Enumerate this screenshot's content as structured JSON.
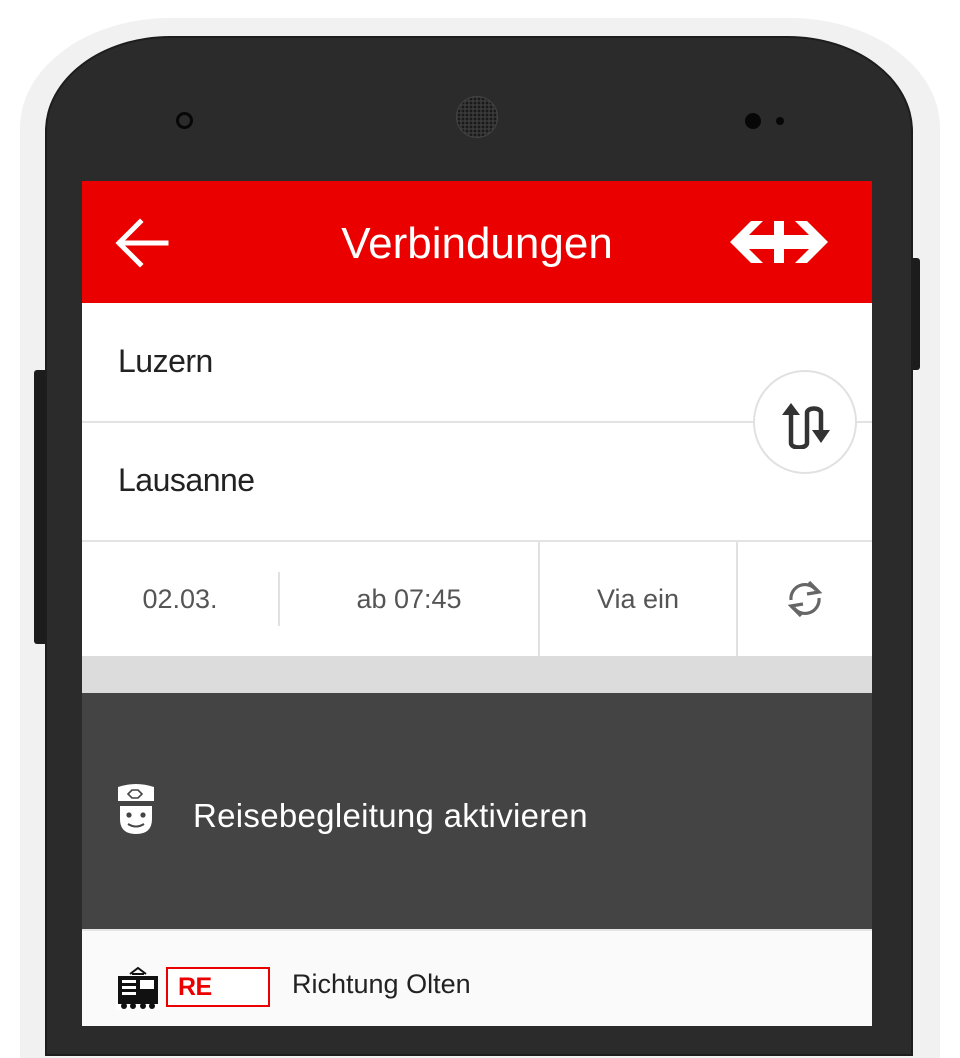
{
  "app": {
    "title": "Verbindungen",
    "accent_color": "#eb0000",
    "back_icon": "arrow-left-icon",
    "logo": "sbb-logo"
  },
  "search": {
    "from": "Luzern",
    "to": "Lausanne",
    "swap_icon": "swap-direction-icon"
  },
  "options": {
    "date": "02.03.",
    "time": "ab 07:45",
    "via": "Via ein",
    "refresh_icon": "refresh-icon"
  },
  "travel_companion": {
    "label": "Reisebegleitung aktivieren",
    "icon": "conductor-icon",
    "background": "#444444"
  },
  "connection": {
    "train_icon": "train-icon",
    "train_type": "RE",
    "direction": "Richtung Olten"
  }
}
